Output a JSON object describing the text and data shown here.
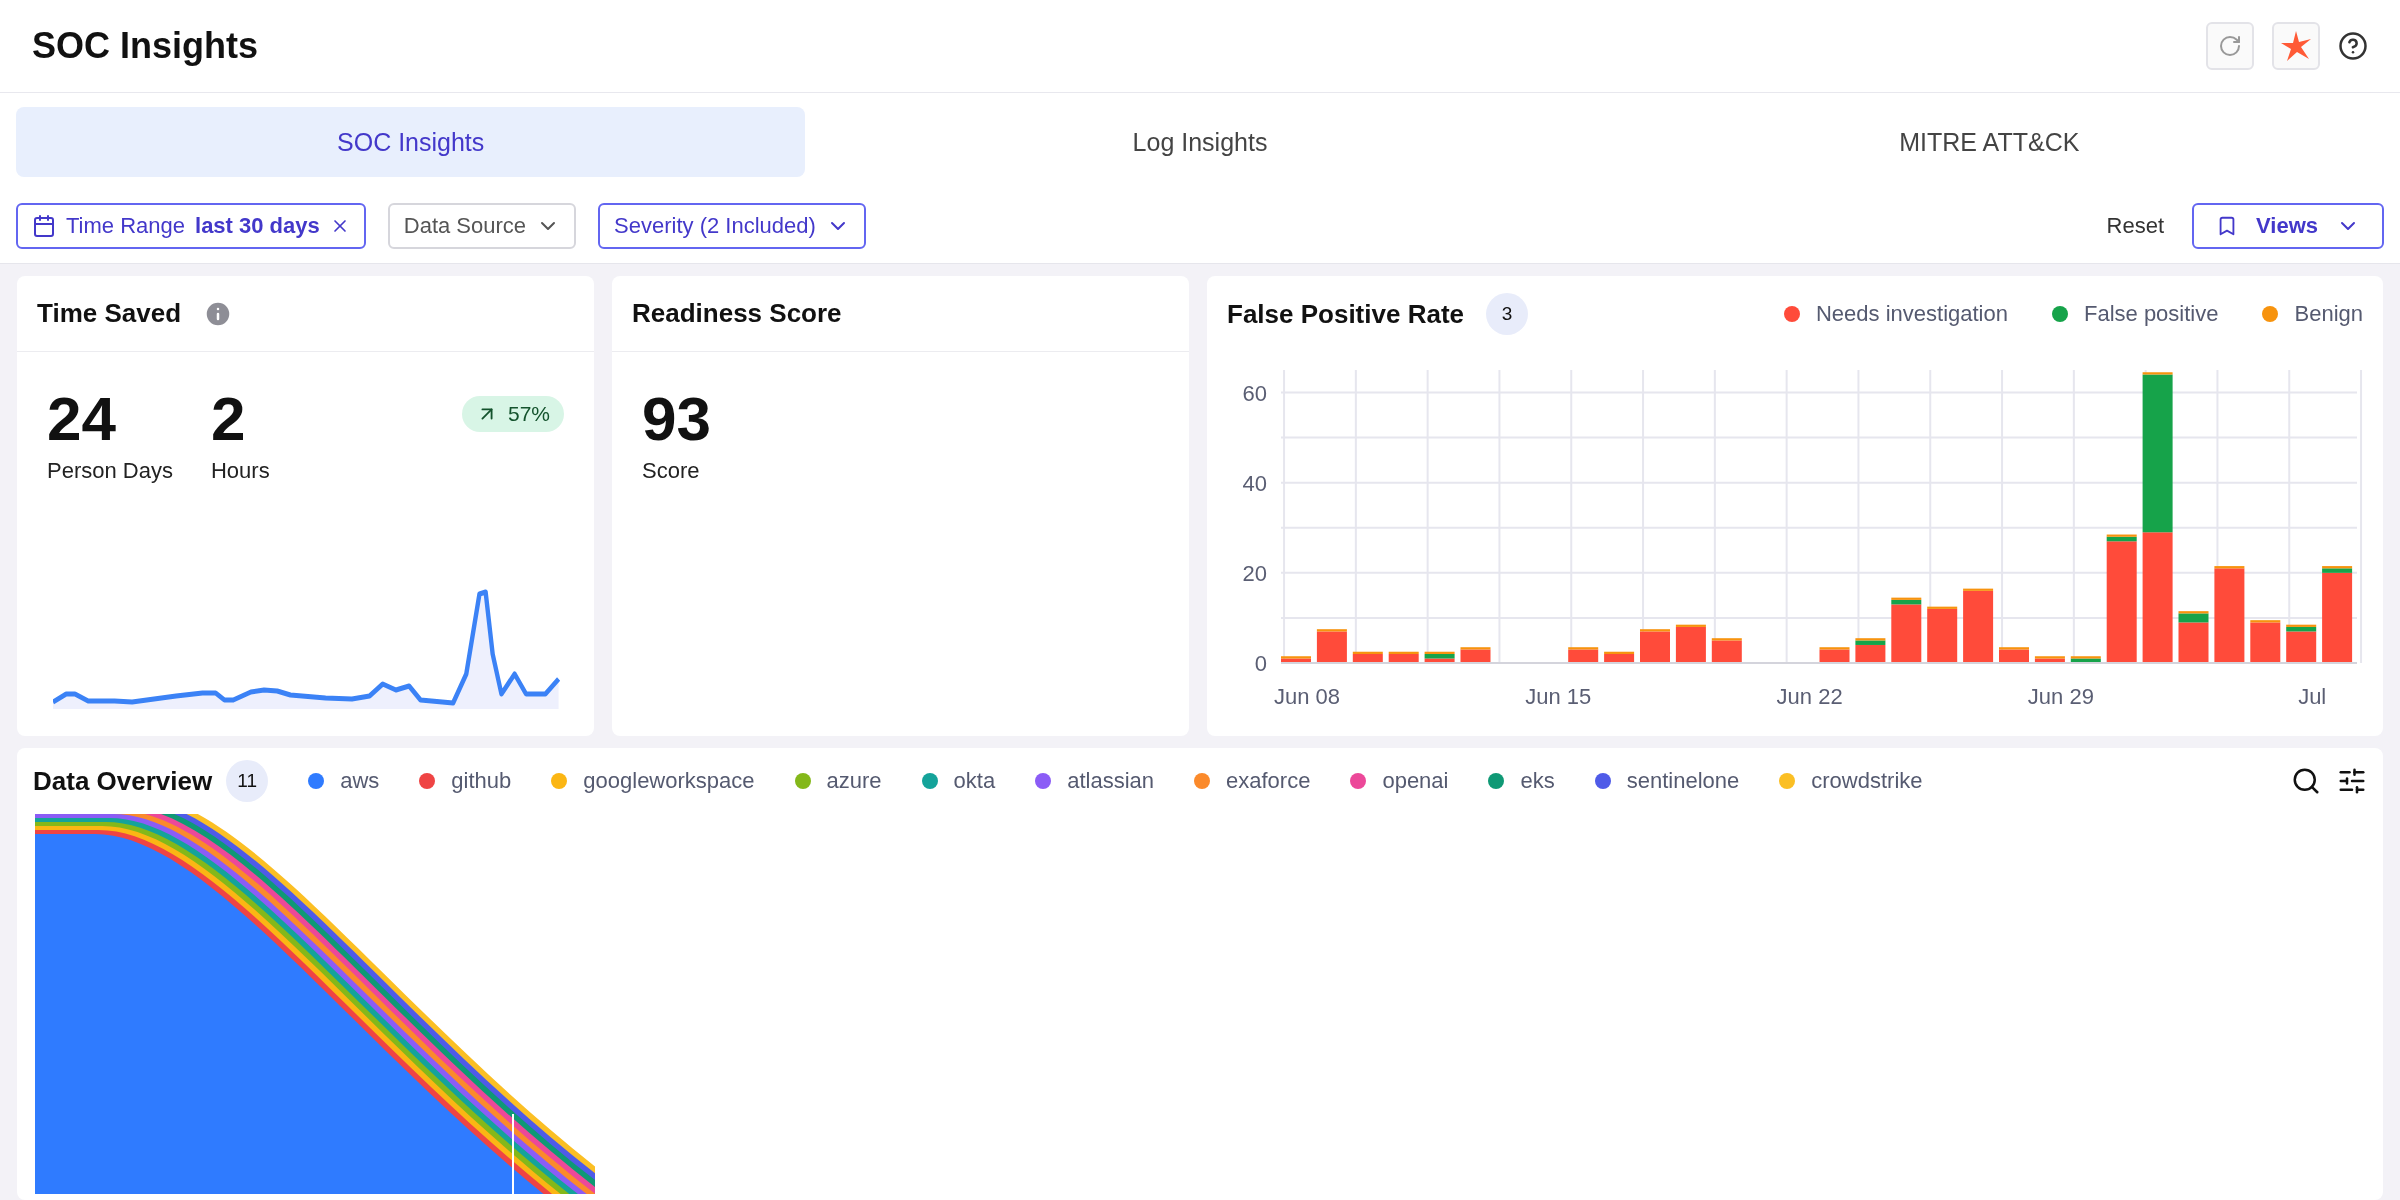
{
  "header": {
    "title": "SOC Insights"
  },
  "tabs": [
    {
      "label": "SOC Insights",
      "selected": true
    },
    {
      "label": "Log Insights",
      "selected": false
    },
    {
      "label": "MITRE ATT&CK",
      "selected": false
    }
  ],
  "filters": [
    {
      "kind": "range",
      "label": "Time Range",
      "value": "last 30 days",
      "active": true
    },
    {
      "kind": "dropdown",
      "label": "Data Source",
      "active": false
    },
    {
      "kind": "dropdown",
      "label": "Severity (2 Included)",
      "active": true
    }
  ],
  "actions": {
    "reset": "Reset",
    "views": "Views"
  },
  "time_saved": {
    "title": "Time Saved",
    "metrics": [
      {
        "value": "24",
        "label": "Person Days"
      },
      {
        "value": "2",
        "label": "Hours"
      }
    ],
    "change": "57%"
  },
  "readiness": {
    "title": "Readiness Score",
    "value": "93",
    "label": "Score"
  },
  "false_positive": {
    "title": "False Positive Rate",
    "count": "3",
    "chart_data": {
      "type": "bar",
      "stacked": true,
      "grid": true,
      "categories": [
        "Jun 08",
        null,
        null,
        null,
        null,
        null,
        null,
        "Jun 15",
        null,
        null,
        null,
        null,
        null,
        null,
        "Jun 22",
        null,
        null,
        null,
        null,
        null,
        null,
        "Jun 29",
        null,
        null,
        null,
        null,
        null,
        null,
        "Jul",
        null
      ],
      "series": [
        {
          "name": "Needs investigation",
          "color": "#ff4b3a",
          "values": [
            1,
            7,
            2,
            2,
            1,
            3,
            0,
            0,
            3,
            2,
            7,
            8,
            5,
            0,
            0,
            3,
            4,
            13,
            12,
            16,
            3,
            1,
            0,
            27,
            29,
            9,
            21,
            9,
            7,
            20
          ]
        },
        {
          "name": "False positive",
          "color": "#16a34a",
          "values": [
            0,
            0,
            0,
            0,
            1,
            0,
            0,
            0,
            0,
            0,
            0,
            0,
            0,
            0,
            0,
            0,
            1,
            1,
            0,
            0,
            0,
            0,
            1,
            1,
            35,
            2,
            0,
            0,
            1,
            1
          ]
        },
        {
          "name": "Benign",
          "color": "#f7930e",
          "values": [
            0.5,
            0.5,
            0.5,
            0.5,
            0.5,
            0.5,
            0,
            0,
            0.5,
            0.5,
            0.5,
            0.5,
            0.5,
            0,
            0,
            0.5,
            0.5,
            0.5,
            0.5,
            0.5,
            0.5,
            0.5,
            0.5,
            0.5,
            0.5,
            0.5,
            0.5,
            0.5,
            0.5,
            0.5
          ]
        }
      ],
      "ylim": [
        0,
        65
      ],
      "yticks": [
        0,
        20,
        40,
        60
      ]
    }
  },
  "data_overview": {
    "title": "Data Overview",
    "count": "11",
    "sources": [
      {
        "name": "aws",
        "color": "#2f7bff"
      },
      {
        "name": "github",
        "color": "#ef4444"
      },
      {
        "name": "googleworkspace",
        "color": "#fbb614"
      },
      {
        "name": "azure",
        "color": "#84b81a"
      },
      {
        "name": "okta",
        "color": "#14a39a"
      },
      {
        "name": "atlassian",
        "color": "#8b5cf6"
      },
      {
        "name": "exaforce",
        "color": "#fb8a2b"
      },
      {
        "name": "openai",
        "color": "#ec4899"
      },
      {
        "name": "eks",
        "color": "#0f9975"
      },
      {
        "name": "sentinelone",
        "color": "#4f5be8"
      },
      {
        "name": "crowdstrike",
        "color": "#fbbf24"
      }
    ]
  }
}
